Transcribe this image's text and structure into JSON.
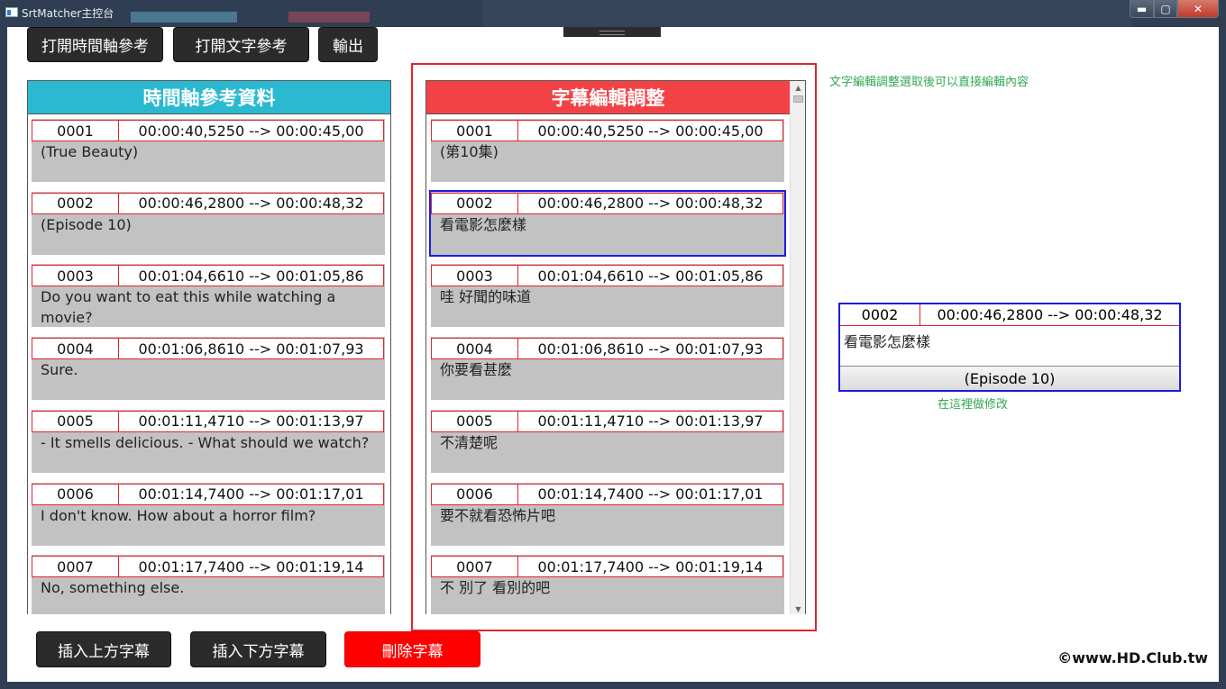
{
  "window": {
    "title": "SrtMatcher主控台",
    "min_glyph": "▬",
    "max_glyph": "▢",
    "close_glyph": "✕"
  },
  "toolbar": {
    "open_timeline_ref": "打開時間軸參考",
    "open_text_ref": "打開文字參考",
    "export": "輸出"
  },
  "reference_panel": {
    "title": "時間軸參考資料",
    "entries": [
      {
        "num": "0001",
        "time": "00:00:40,5250 --> 00:00:45,00",
        "text": "(True Beauty)"
      },
      {
        "num": "0002",
        "time": "00:00:46,2800 --> 00:00:48,32",
        "text": "(Episode 10)"
      },
      {
        "num": "0003",
        "time": "00:01:04,6610 --> 00:01:05,86",
        "text": "Do you want to eat this while watching a movie?"
      },
      {
        "num": "0004",
        "time": "00:01:06,8610 --> 00:01:07,93",
        "text": "Sure."
      },
      {
        "num": "0005",
        "time": "00:01:11,4710 --> 00:01:13,97",
        "text": "- It smells delicious. - What should we watch?"
      },
      {
        "num": "0006",
        "time": "00:01:14,7400 --> 00:01:17,01",
        "text": "I don't know. How about a horror film?"
      },
      {
        "num": "0007",
        "time": "00:01:17,7400 --> 00:01:19,14",
        "text": "No, something else."
      }
    ]
  },
  "edit_panel": {
    "title": "字幕編輯調整",
    "entries": [
      {
        "num": "0001",
        "time": "00:00:40,5250 --> 00:00:45,00",
        "text": "(第10集)"
      },
      {
        "num": "0002",
        "time": "00:00:46,2800 --> 00:00:48,32",
        "text": "看電影怎麼樣"
      },
      {
        "num": "0003",
        "time": "00:01:04,6610 --> 00:01:05,86",
        "text": "哇 好聞的味道"
      },
      {
        "num": "0004",
        "time": "00:01:06,8610 --> 00:01:07,93",
        "text": "你要看甚麼"
      },
      {
        "num": "0005",
        "time": "00:01:11,4710 --> 00:01:13,97",
        "text": "不清楚呢"
      },
      {
        "num": "0006",
        "time": "00:01:14,7400 --> 00:01:17,01",
        "text": "要不就看恐怖片吧"
      },
      {
        "num": "0007",
        "time": "00:01:17,7400 --> 00:01:19,14",
        "text": "不 別了 看別的吧"
      }
    ],
    "selected_index": 1
  },
  "hints": {
    "top": "文字編輯調整選取後可以直接編輯內容",
    "bottom": "在這裡做修改"
  },
  "detail": {
    "num": "0002",
    "time": "00:00:46,2800 --> 00:00:48,32",
    "text": "看電影怎麼樣",
    "reference": "(Episode 10)"
  },
  "bottom_buttons": {
    "insert_above": "插入上方字幕",
    "insert_below": "插入下方字幕",
    "delete": "刪除字幕"
  },
  "watermark": "©www.HD.Club.tw",
  "colors": {
    "ref_header": "#2ab9d1",
    "edit_header": "#f34245",
    "delete_button": "#ff0000",
    "hint": "#34a853",
    "selection": "#1d1de0"
  }
}
